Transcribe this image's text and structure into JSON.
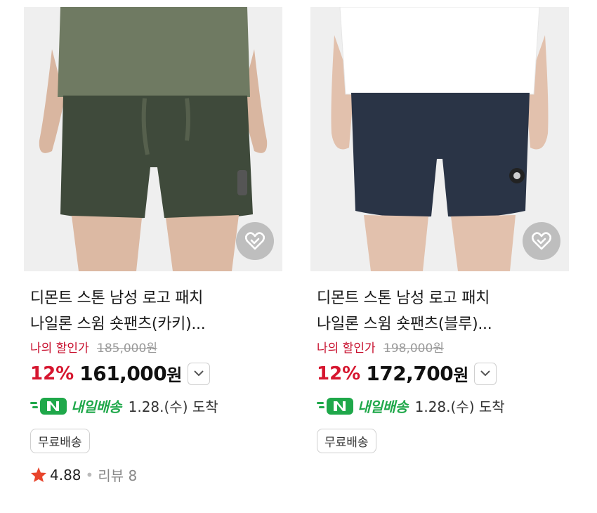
{
  "products": [
    {
      "title_lines": [
        "디몬트 스톤 남성 로고 패치",
        "나일론 스윔 숏팬츠(카키)..."
      ],
      "discount_label": "나의 할인가",
      "original_price": "185,000원",
      "discount_pct": "12%",
      "price": "161,000",
      "price_unit": "원",
      "delivery_brand": "내일배송",
      "delivery_date": "1.28.(수) 도착",
      "free_shipping": "무료배송",
      "rating": "4.88",
      "review_label": "리뷰 8",
      "shorts_color": "#3f4a3b",
      "shirt_color": "#6f7a62"
    },
    {
      "title_lines": [
        "디몬트 스톤 남성 로고 패치",
        "나일론 스윔 숏팬츠(블루)..."
      ],
      "discount_label": "나의 할인가",
      "original_price": "198,000원",
      "discount_pct": "12%",
      "price": "172,700",
      "price_unit": "원",
      "delivery_brand": "내일배송",
      "delivery_date": "1.28.(수) 도착",
      "free_shipping": "무료배송",
      "shorts_color": "#2a3446",
      "shirt_color": "#ffffff"
    }
  ],
  "colors": {
    "accent_red": "#d6162f",
    "delivery_green": "#1fa84a",
    "star": "#e8452c"
  }
}
